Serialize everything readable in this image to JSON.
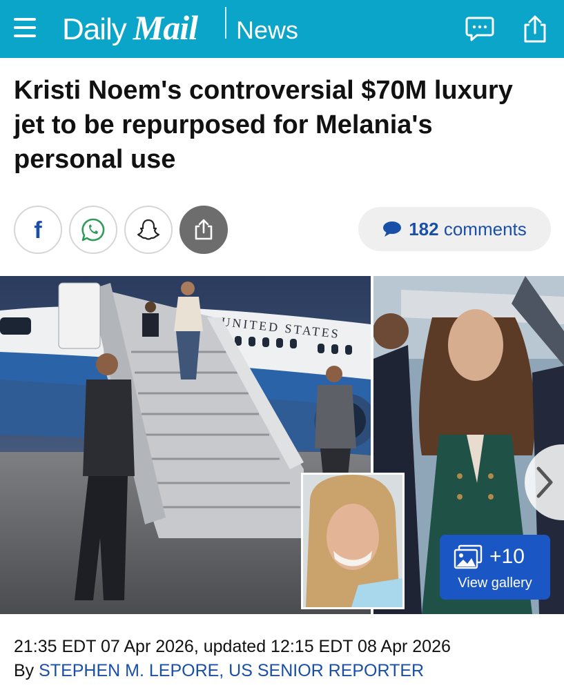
{
  "header": {
    "brand_daily": "Daily",
    "brand_mail": "Mail",
    "section": "News",
    "menu_icon": "hamburger-menu-icon",
    "comments_icon": "speech-bubble-icon",
    "share_icon": "share-icon",
    "bg_color": "#0aa5c9"
  },
  "article": {
    "headline": "Kristi Noem's controversial $70M luxury jet to be repurposed for Melania's personal use",
    "timestamp": "21:35 EDT 07 Apr 2026, updated 12:15 EDT 08 Apr 2026",
    "byline_prefix": "By ",
    "author": "STEPHEN M. LEPORE, US SENIOR REPORTER"
  },
  "share": {
    "buttons": [
      {
        "name": "facebook",
        "icon": "facebook-icon",
        "glyph": "f"
      },
      {
        "name": "whatsapp",
        "icon": "whatsapp-icon"
      },
      {
        "name": "snapchat",
        "icon": "snapchat-icon"
      },
      {
        "name": "share",
        "icon": "share-icon"
      }
    ],
    "comments_count": "182",
    "comments_label": "comments",
    "accent": "#1a4fa8"
  },
  "gallery": {
    "plane_text": "UNITED STATES",
    "more_count": "+10",
    "view_label": "View gallery",
    "next_icon": "chevron-right-icon",
    "gallery_icon": "photo-stack-icon",
    "button_color": "#1a56c4"
  }
}
